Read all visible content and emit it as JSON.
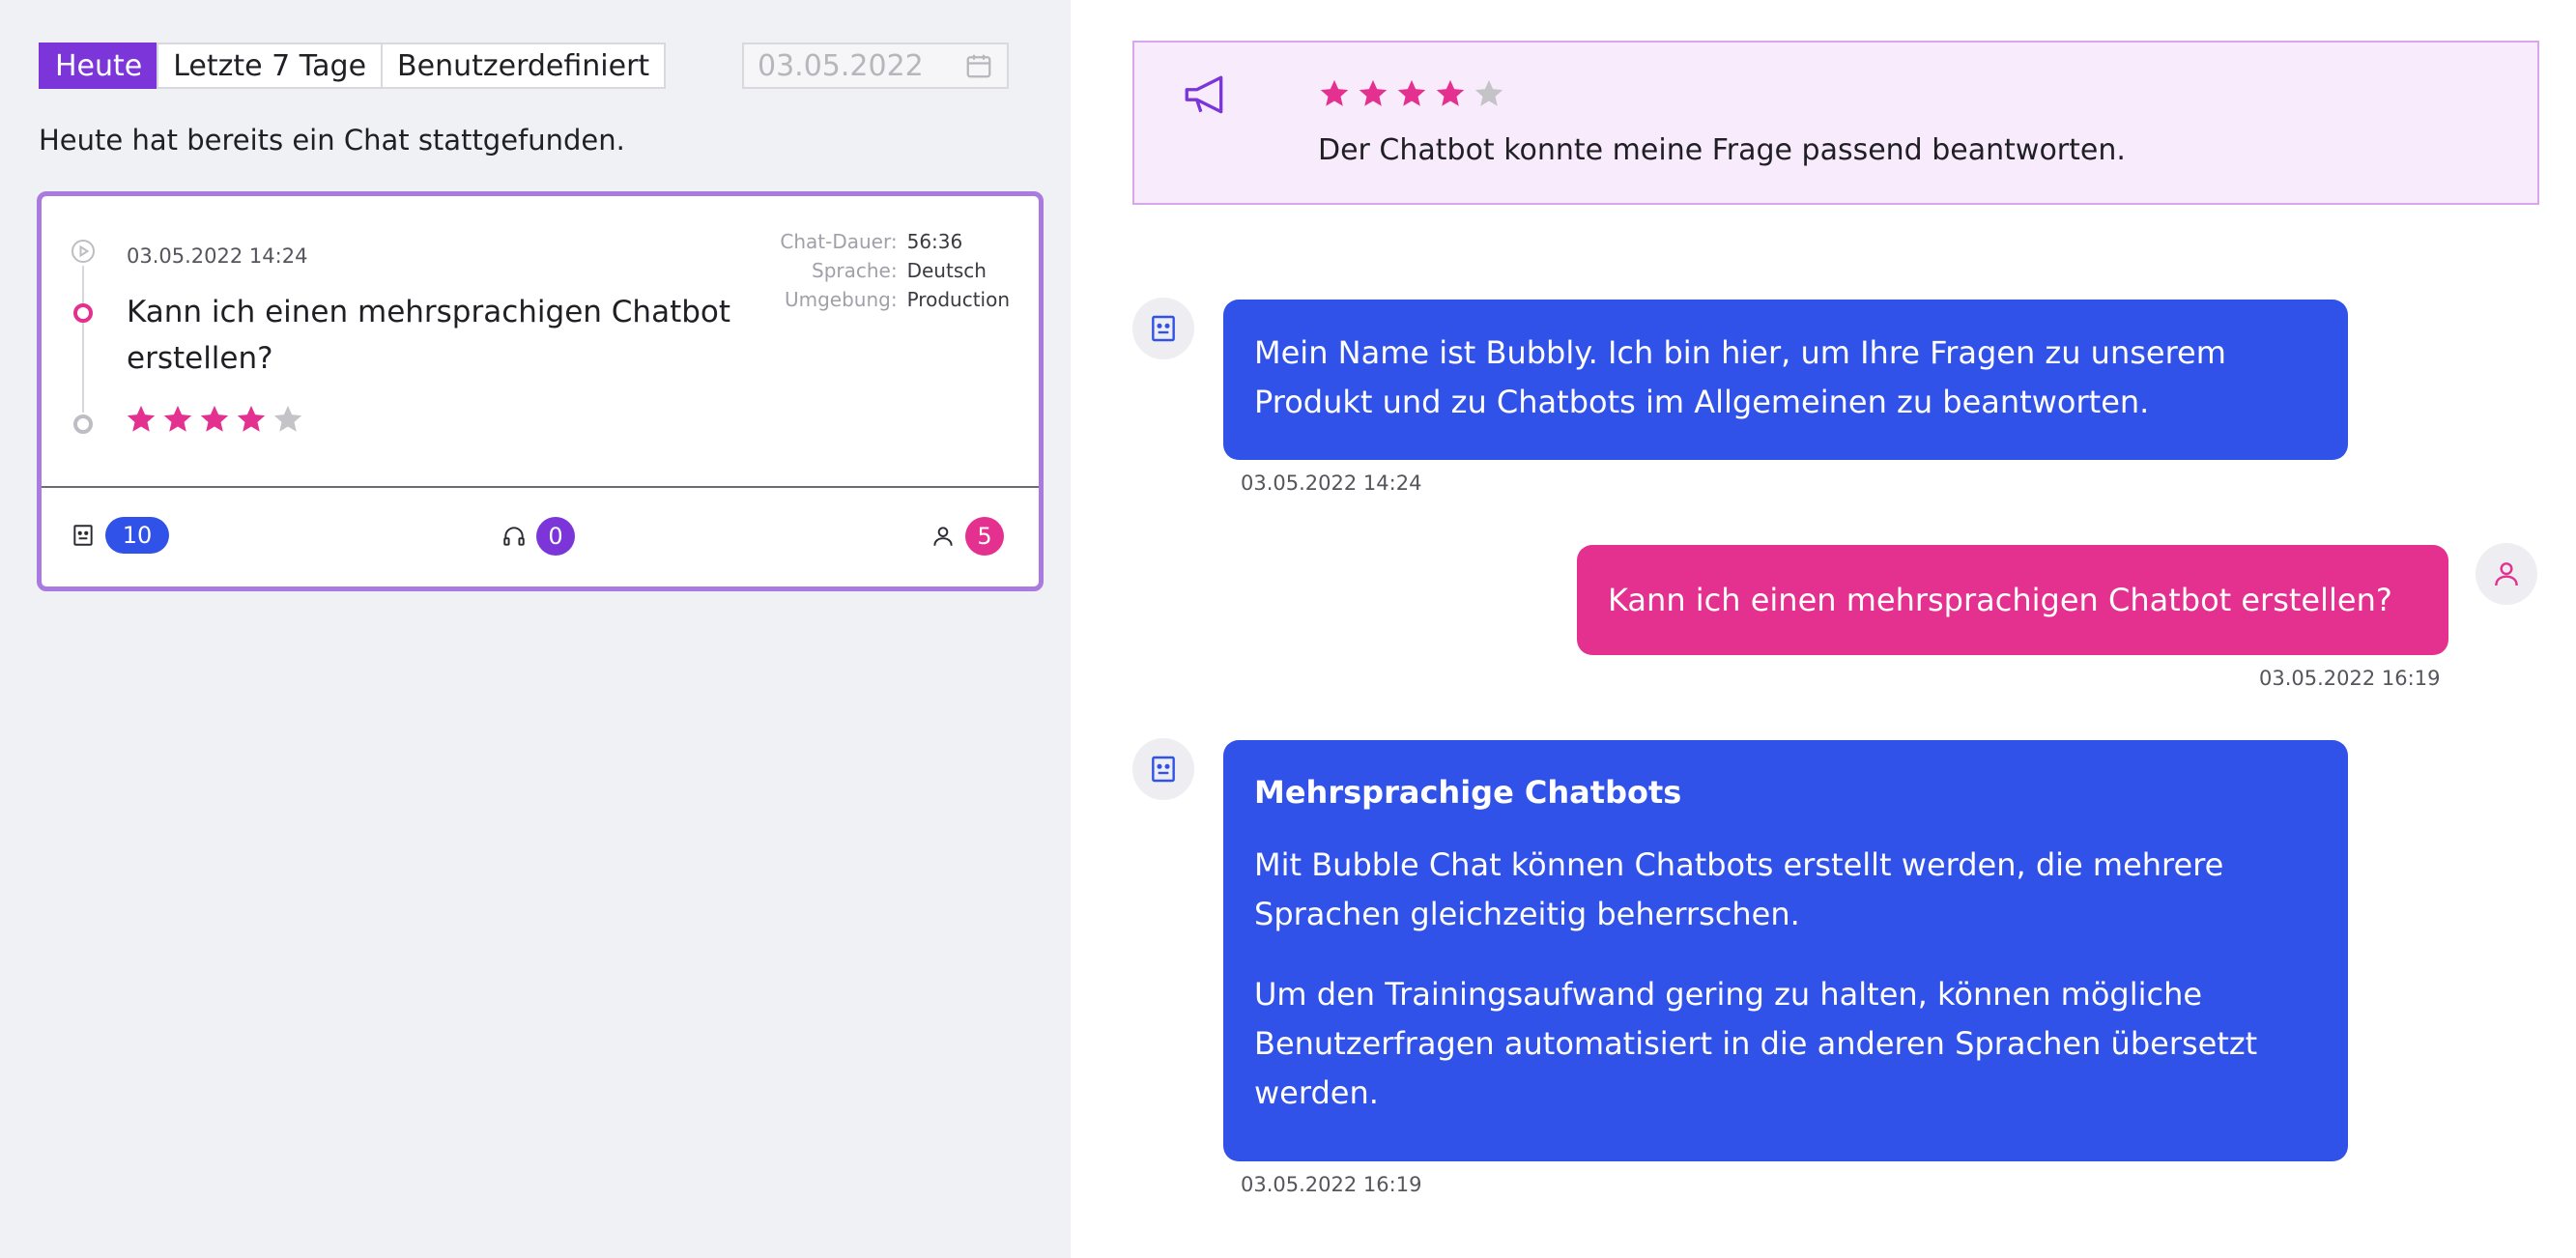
{
  "filters": {
    "tabs": [
      {
        "label": "Heute",
        "active": true
      },
      {
        "label": "Letzte 7 Tage",
        "active": false
      },
      {
        "label": "Benutzerdefiniert",
        "active": false
      }
    ],
    "date_placeholder": "03.05.2022",
    "date_icon": "calendar-icon"
  },
  "summary_text": "Heute hat bereits ein Chat stattgefunden.",
  "chat_card": {
    "datetime": "03.05.2022 14:24",
    "question": "Kann ich einen mehrsprachigen Chatbot erstellen?",
    "rating": 4,
    "rating_max": 5,
    "meta": [
      {
        "label": "Chat-Dauer:",
        "value": "56:36"
      },
      {
        "label": "Sprache:",
        "value": "Deutsch"
      },
      {
        "label": "Umgebung:",
        "value": "Production"
      }
    ],
    "counts": {
      "bot": {
        "icon": "bot-icon",
        "value": "10"
      },
      "agent": {
        "icon": "headset-icon",
        "value": "0"
      },
      "user": {
        "icon": "user-icon",
        "value": "5"
      }
    }
  },
  "feedback": {
    "icon": "megaphone-icon",
    "rating": 4,
    "rating_max": 5,
    "text": "Der Chatbot konnte meine Frage passend beantworten."
  },
  "messages": [
    {
      "sender": "bot",
      "text": "Mein Name ist Bubbly. Ich bin hier, um Ihre Fragen zu unserem Produkt und zu Chatbots im Allgemeinen zu beantworten.",
      "time": "03.05.2022 14:24"
    },
    {
      "sender": "user",
      "text": "Kann ich einen mehrsprachigen Chatbot erstellen?",
      "time": "03.05.2022 16:19"
    },
    {
      "sender": "bot",
      "heading": "Mehrsprachige Chatbots",
      "paragraphs": [
        "Mit Bubble Chat können Chatbots erstellt werden, die mehrere Sprachen gleichzeitig beherrschen.",
        "Um den Trainingsaufwand gering zu halten, können mögliche Benutzerfragen automatisiert in die anderen Sprachen übersetzt werden."
      ],
      "time": "03.05.2022 16:19"
    }
  ],
  "colors": {
    "accent_purple": "#7b35d8",
    "bot_blue": "#3052e8",
    "user_pink": "#e4308f",
    "star_filled": "#e4308f",
    "star_empty": "#c4c4c8"
  }
}
